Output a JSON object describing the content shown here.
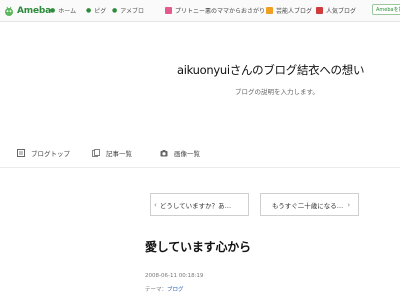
{
  "topbar": {
    "logo_text": "Ameba",
    "nav": [
      {
        "label": "ホーム"
      },
      {
        "label": "ピグ"
      },
      {
        "label": "アメブロ"
      }
    ],
    "promos": [
      {
        "label": "プリトニー悪のママからおさがり",
        "color": "#e35a8c"
      },
      {
        "label": "芸能人ブログ",
        "color": "#f0a020"
      },
      {
        "label": "人気ブログ",
        "color": "#d03c3c"
      }
    ],
    "button_label": "Amebaを始めよう"
  },
  "header": {
    "title": "aikuonyuiさんのブログ結衣への想い",
    "description": "ブログの説明を入力します。"
  },
  "subnav": {
    "items": [
      {
        "label": "ブログトップ",
        "icon": "blog-top-icon"
      },
      {
        "label": "記事一覧",
        "icon": "article-list-icon"
      },
      {
        "label": "画像一覧",
        "icon": "camera-icon"
      }
    ]
  },
  "pager": {
    "prev_label": "どうしていますか？あ…",
    "next_label": "もうすぐ二十歳になる…"
  },
  "entry": {
    "title": "愛しています心から",
    "date": "2008-06-11 00:18:19",
    "theme_prefix": "テーマ：",
    "theme_link": "ブログ"
  }
}
